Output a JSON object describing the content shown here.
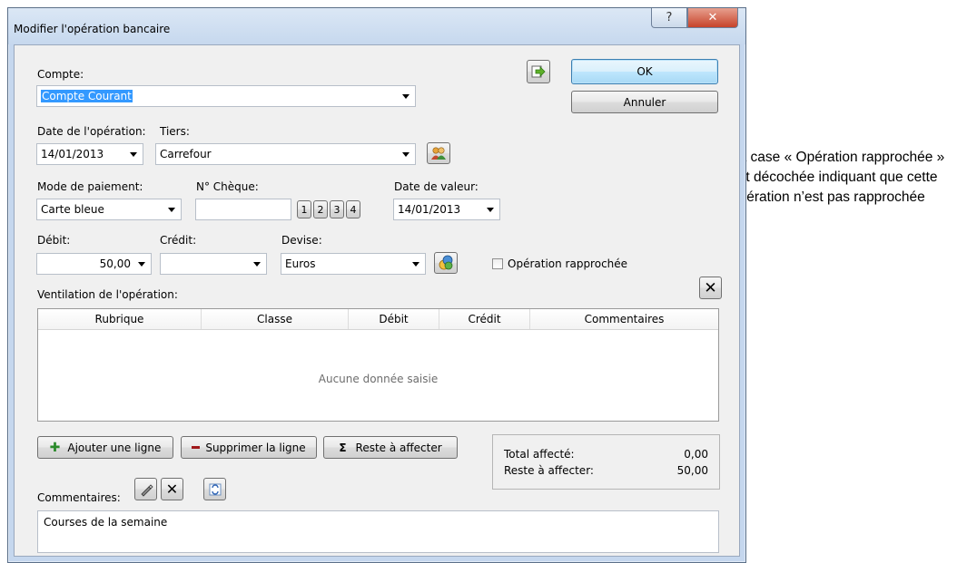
{
  "window": {
    "title": "Modifier l'opération bancaire",
    "help_icon": "question-icon",
    "close_icon": "close-x-icon"
  },
  "account": {
    "label": "Compte:",
    "value": "Compte Courant"
  },
  "buttons": {
    "ok": "OK",
    "cancel": "Annuler",
    "export_icon": "export-arrow-icon"
  },
  "date_operation": {
    "label": "Date de l'opération:",
    "value": "14/01/2013"
  },
  "payee": {
    "label": "Tiers:",
    "value": "Carrefour",
    "icon": "contacts-icon"
  },
  "payment_mode": {
    "label": "Mode de paiement:",
    "value": "Carte bleue"
  },
  "cheque": {
    "label": "N° Chèque:",
    "value": "",
    "buttons": [
      "1",
      "2",
      "3",
      "4"
    ]
  },
  "value_date": {
    "label": "Date de valeur:",
    "value": "14/01/2013"
  },
  "debit": {
    "label": "Débit:",
    "value": "50,00"
  },
  "credit": {
    "label": "Crédit:",
    "value": ""
  },
  "currency": {
    "label": "Devise:",
    "value": "Euros",
    "icon": "currency-icon"
  },
  "reconciled": {
    "label": "Opération rapprochée",
    "checked": false
  },
  "breakdown": {
    "label": "Ventilation de l'opération:",
    "clear_icon": "clear-x-icon",
    "columns": [
      "Rubrique",
      "Classe",
      "Débit",
      "Crédit",
      "Commentaires"
    ],
    "empty_message": "Aucune donnée saisie",
    "add_line": "Ajouter une ligne",
    "delete_line": "Supprimer la ligne",
    "remaining_assign": "Reste à affecter",
    "sigma_symbol": "Σ"
  },
  "totals": {
    "assigned_label": "Total affecté:",
    "assigned_value": "0,00",
    "remaining_label": "Reste à affecter:",
    "remaining_value": "50,00"
  },
  "comments": {
    "label": "Commentaires:",
    "value": "Courses de la semaine",
    "tool_icons": [
      "edit-pencil-icon",
      "clear-x-icon",
      "refresh-icon"
    ]
  },
  "annotation": {
    "text": "La case « Opération rapprochée » est décochée indiquant que cette opération n’est pas rapprochée"
  }
}
